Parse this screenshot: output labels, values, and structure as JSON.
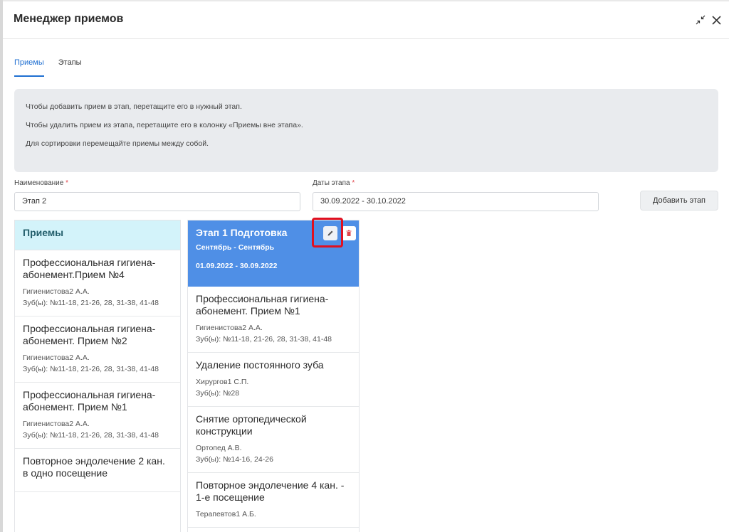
{
  "modal": {
    "title": "Менеджер приемов"
  },
  "tabs": [
    {
      "label": "Приемы",
      "active": true
    },
    {
      "label": "Этапы",
      "active": false
    }
  ],
  "info": {
    "lines": [
      "Чтобы добавить прием в этап, перетащите его в нужный этап.",
      "Чтобы удалить прием из этапа, перетащите его в колонку «Приемы вне этапа».",
      "Для сортировки перемещайте приемы между собой."
    ]
  },
  "form": {
    "name_label": "Наименование",
    "name_value": "Этап 2",
    "dates_label": "Даты этапа",
    "dates_value": "30.09.2022 - 30.10.2022",
    "required_mark": "*",
    "add_stage_label": "Добавить этап"
  },
  "left_column": {
    "title": "Приемы",
    "cards": [
      {
        "title": "Профессиональная гигиена-абонемент.Прием №4",
        "doctor": "Гигиенистова2 А.А.",
        "teeth": "Зуб(ы): №11-18, 21-26, 28, 31-38, 41-48"
      },
      {
        "title": "Профессиональная гигиена-абонемент. Прием №2",
        "doctor": "Гигиенистова2 А.А.",
        "teeth": "Зуб(ы): №11-18, 21-26, 28, 31-38, 41-48"
      },
      {
        "title": "Профессиональная гигиена-абонемент. Прием №1",
        "doctor": "Гигиенистова2 А.А.",
        "teeth": "Зуб(ы): №11-18, 21-26, 28, 31-38, 41-48"
      },
      {
        "title": "Повторное эндолечение 2 кан. в одно посещение",
        "doctor": "",
        "teeth": ""
      }
    ]
  },
  "stage_column": {
    "name": "Этап 1 Подготовка",
    "months": "Сентябрь - Сентябрь",
    "dates": "01.09.2022 - 30.09.2022",
    "colors": {
      "header": "#4f8fe6",
      "highlight": "#e01020"
    },
    "icons": {
      "edit": "pencil-icon",
      "delete": "trash-icon"
    },
    "cards": [
      {
        "title": "Профессиональная гигиена-абонемент. Прием №1",
        "doctor": "Гигиенистова2 А.А.",
        "teeth": "Зуб(ы): №11-18, 21-26, 28, 31-38, 41-48"
      },
      {
        "title": "Удаление постоянного зуба",
        "doctor": "Хирургов1 С.П.",
        "teeth": "Зуб(ы): №28"
      },
      {
        "title": "Снятие ортопедической конструкции",
        "doctor": "Ортопед А.В.",
        "teeth": "Зуб(ы): №14-16, 24-26"
      },
      {
        "title": "Повторное эндолечение 4 кан. - 1-е посещение",
        "doctor": "Терапевтов1 А.Б.",
        "teeth": ""
      }
    ]
  }
}
